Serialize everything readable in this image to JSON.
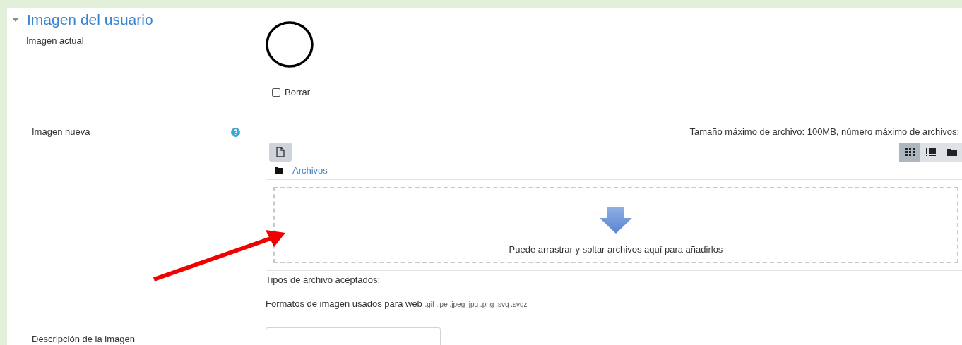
{
  "section": {
    "title": "Imagen del usuario",
    "expanded": true
  },
  "current_image": {
    "label": "Imagen actual",
    "delete": {
      "label": "Borrar",
      "checked": false
    }
  },
  "new_image": {
    "label": "Imagen nueva",
    "limits": "Tamaño máximo de archivo: 100MB, número máximo de archivos:",
    "view_modes": [
      {
        "kind": "icons",
        "selected": true
      },
      {
        "kind": "list",
        "selected": false
      },
      {
        "kind": "tree",
        "selected": false
      }
    ],
    "path": "Archivos",
    "drop_hint": "Puede arrastrar y soltar archivos aquí para añadirlos",
    "accepted_label": "Tipos de archivo aceptados:",
    "formats": "Formatos de imagen usados para web",
    "extensions": ".gif .jpe .jpeg .jpg .png .svg .svgz"
  },
  "description": {
    "label": "Descripción de la imagen"
  }
}
